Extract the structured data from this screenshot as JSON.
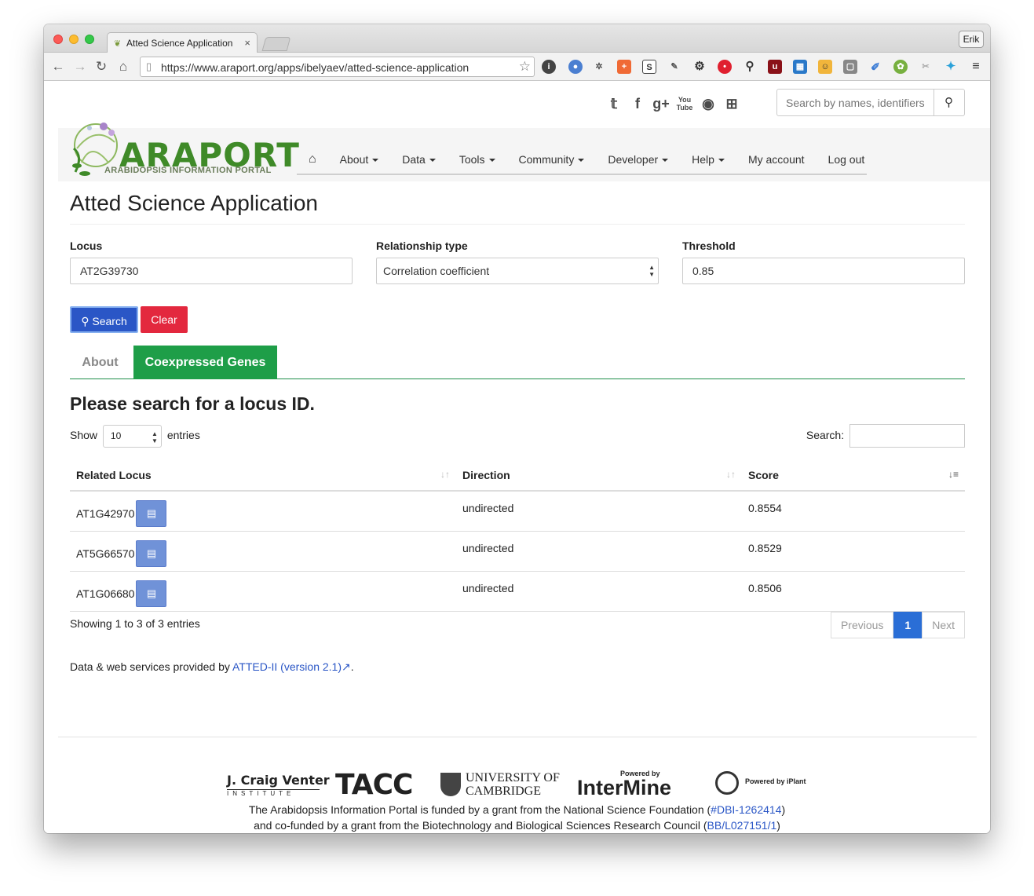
{
  "browser": {
    "tab_title": "Atted Science Application",
    "tab_close": "×",
    "user_label": "Erik",
    "url": "https://www.araport.org/apps/ibelyaev/atted-science-application"
  },
  "header": {
    "search_placeholder": "Search by names, identifiers",
    "logo_word": "ARAPORT",
    "logo_sub": "ARABIDOPSIS INFORMATION PORTAL",
    "nav": [
      "About",
      "Data",
      "Tools",
      "Community",
      "Developer",
      "Help",
      "My account",
      "Log out"
    ]
  },
  "page_title": "Atted Science Application",
  "form": {
    "locus_label": "Locus",
    "locus_value": "AT2G39730",
    "relationship_label": "Relationship type",
    "relationship_value": "Correlation coefficient",
    "threshold_label": "Threshold",
    "threshold_value": "0.85",
    "search_button": "Search",
    "clear_button": "Clear"
  },
  "tabs": [
    "About",
    "Coexpressed Genes"
  ],
  "results": {
    "heading": "Please search for a locus ID.",
    "show_label": "Show",
    "page_length": "10",
    "entries_label": "entries",
    "search_label": "Search:",
    "columns": [
      "Related Locus",
      "Direction",
      "Score"
    ],
    "rows": [
      {
        "locus": "AT1G42970",
        "direction": "undirected",
        "score": "0.8554"
      },
      {
        "locus": "AT5G66570",
        "direction": "undirected",
        "score": "0.8529"
      },
      {
        "locus": "AT1G06680",
        "direction": "undirected",
        "score": "0.8506"
      }
    ],
    "info": "Showing 1 to 3 of 3 entries",
    "previous": "Previous",
    "current_page": "1",
    "next": "Next"
  },
  "attribution": {
    "prefix": "Data & web services provided by ",
    "link": "ATTED-II (version 2.1)",
    "suffix": "."
  },
  "footer": {
    "sponsors": [
      "J. Craig Venter",
      "INSTITUTE",
      "TACC",
      "UNIVERSITY OF",
      "CAMBRIDGE",
      "Powered by",
      "InterMine",
      "Powered by iPlant"
    ],
    "line1_prefix": "The Arabidopsis Information Portal is funded by a grant from the National Science Foundation (",
    "line1_link": "#DBI-1262414",
    "line1_suffix": ")",
    "line2_prefix": "and co-funded by a grant from the Biotechnology and Biological Sciences Research Council (",
    "line2_link": "BB/L027151/1",
    "line2_suffix": ")"
  },
  "icons": {
    "social": [
      "twitter-icon",
      "facebook-icon",
      "google-plus-icon",
      "youtube-icon",
      "github-icon",
      "slideshare-icon"
    ]
  },
  "colors": {
    "brand_green": "#3f8a28",
    "tab_active": "#1e9e48",
    "search_button": "#2a56c6",
    "clear_button": "#e3283e",
    "link": "#2a56c6"
  }
}
